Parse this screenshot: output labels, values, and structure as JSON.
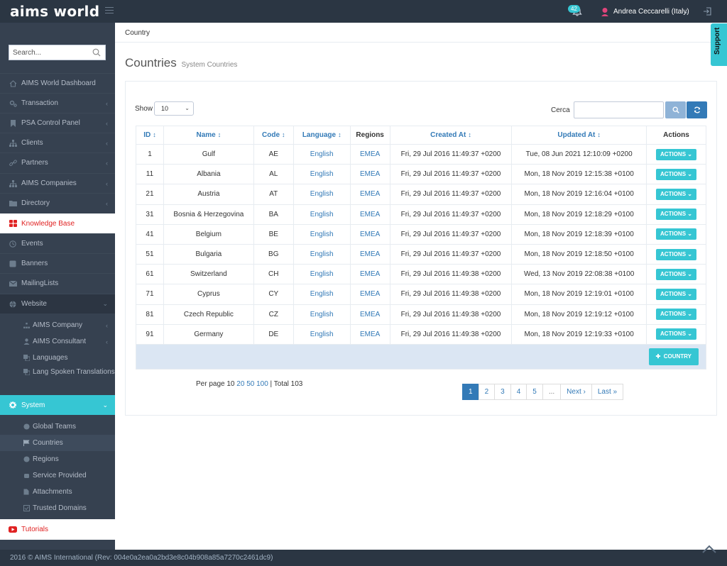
{
  "header": {
    "logo": "aims world",
    "notifications_count": "42",
    "user_name": "Andrea Ceccarelli (Italy)"
  },
  "sidebar": {
    "search_placeholder": "Search...",
    "items": [
      {
        "label": "AIMS World Dashboard",
        "icon": "home-icon"
      },
      {
        "label": "Transaction",
        "icon": "cogs-icon"
      },
      {
        "label": "PSA Control Panel",
        "icon": "bookmark-icon"
      },
      {
        "label": "Clients",
        "icon": "sitemap-icon"
      },
      {
        "label": "Partners",
        "icon": "link-icon"
      },
      {
        "label": "AIMS Companies",
        "icon": "sitemap-icon"
      },
      {
        "label": "Directory",
        "icon": "folder-icon"
      },
      {
        "label": "Knowledge Base",
        "icon": "grid-icon"
      },
      {
        "label": "Events",
        "icon": "clock-icon"
      },
      {
        "label": "Banners",
        "icon": "square-icon"
      },
      {
        "label": "MailingLists",
        "icon": "envelope-icon"
      },
      {
        "label": "Website",
        "icon": "globe-icon"
      }
    ],
    "website_sub": [
      {
        "label": "AIMS Company"
      },
      {
        "label": "AIMS Consultant"
      },
      {
        "label": "Languages"
      },
      {
        "label": "Lang Spoken Translations"
      }
    ],
    "system_label": "System",
    "system_sub": [
      {
        "label": "Global Teams"
      },
      {
        "label": "Countries"
      },
      {
        "label": "Regions"
      },
      {
        "label": "Service Provided"
      },
      {
        "label": "Attachments"
      },
      {
        "label": "Trusted Domains"
      }
    ],
    "tutorials_label": "Tutorials"
  },
  "breadcrumb": "Country",
  "support_label": "Support",
  "page": {
    "title": "Countries",
    "subtitle": "System Countries"
  },
  "controls": {
    "show_label": "Show",
    "show_value": "10",
    "cerca_label": "Cerca",
    "cerca_value": ""
  },
  "table": {
    "headers": [
      "ID",
      "Name",
      "Code",
      "Language",
      "Regions",
      "Created At",
      "Updated At",
      "Actions"
    ],
    "rows": [
      {
        "id": "1",
        "name": "Gulf",
        "code": "AE",
        "language": "English",
        "region": "EMEA",
        "created": "Fri, 29 Jul 2016 11:49:37 +0200",
        "updated": "Tue, 08 Jun 2021 12:10:09 +0200"
      },
      {
        "id": "11",
        "name": "Albania",
        "code": "AL",
        "language": "English",
        "region": "EMEA",
        "created": "Fri, 29 Jul 2016 11:49:37 +0200",
        "updated": "Mon, 18 Nov 2019 12:15:38 +0100"
      },
      {
        "id": "21",
        "name": "Austria",
        "code": "AT",
        "language": "English",
        "region": "EMEA",
        "created": "Fri, 29 Jul 2016 11:49:37 +0200",
        "updated": "Mon, 18 Nov 2019 12:16:04 +0100"
      },
      {
        "id": "31",
        "name": "Bosnia & Herzegovina",
        "code": "BA",
        "language": "English",
        "region": "EMEA",
        "created": "Fri, 29 Jul 2016 11:49:37 +0200",
        "updated": "Mon, 18 Nov 2019 12:18:29 +0100"
      },
      {
        "id": "41",
        "name": "Belgium",
        "code": "BE",
        "language": "English",
        "region": "EMEA",
        "created": "Fri, 29 Jul 2016 11:49:37 +0200",
        "updated": "Mon, 18 Nov 2019 12:18:39 +0100"
      },
      {
        "id": "51",
        "name": "Bulgaria",
        "code": "BG",
        "language": "English",
        "region": "EMEA",
        "created": "Fri, 29 Jul 2016 11:49:37 +0200",
        "updated": "Mon, 18 Nov 2019 12:18:50 +0100"
      },
      {
        "id": "61",
        "name": "Switzerland",
        "code": "CH",
        "language": "English",
        "region": "EMEA",
        "created": "Fri, 29 Jul 2016 11:49:38 +0200",
        "updated": "Wed, 13 Nov 2019 22:08:38 +0100"
      },
      {
        "id": "71",
        "name": "Cyprus",
        "code": "CY",
        "language": "English",
        "region": "EMEA",
        "created": "Fri, 29 Jul 2016 11:49:38 +0200",
        "updated": "Mon, 18 Nov 2019 12:19:01 +0100"
      },
      {
        "id": "81",
        "name": "Czech Republic",
        "code": "CZ",
        "language": "English",
        "region": "EMEA",
        "created": "Fri, 29 Jul 2016 11:49:38 +0200",
        "updated": "Mon, 18 Nov 2019 12:19:12 +0100"
      },
      {
        "id": "91",
        "name": "Germany",
        "code": "DE",
        "language": "English",
        "region": "EMEA",
        "created": "Fri, 29 Jul 2016 11:49:38 +0200",
        "updated": "Mon, 18 Nov 2019 12:19:33 +0100"
      }
    ],
    "actions_label": "ACTIONS",
    "add_country_label": "COUNTRY"
  },
  "pagination": {
    "per_page_label": "Per page",
    "per_page_current": "10",
    "per_page_options": [
      "20",
      "50",
      "100"
    ],
    "total": "Total 103",
    "pages": [
      "1",
      "2",
      "3",
      "4",
      "5",
      "..."
    ],
    "next": "Next ›",
    "last": "Last »"
  },
  "footer": {
    "text": "2016 © AIMS International (Rev: 004e0a2ea0a2bd3e8c04b908a85a7270c2461dc9)"
  },
  "colors": {
    "header_bg": "#2b3643",
    "sidebar_bg": "#364150",
    "accent_cyan": "#36c6d3",
    "link_blue": "#337ab7",
    "danger_red": "#e02222"
  }
}
